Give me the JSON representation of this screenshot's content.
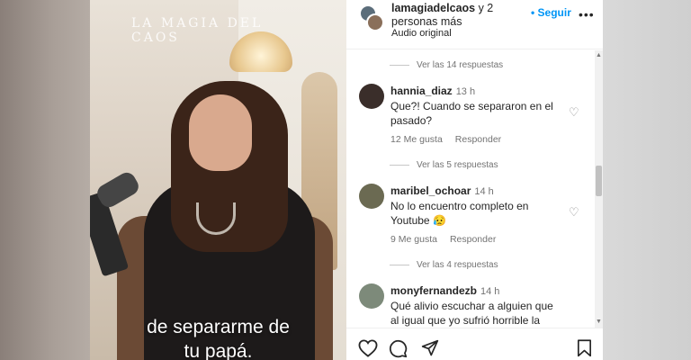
{
  "video": {
    "brand": "LA MAGIA DEL CAOS",
    "caption_line1": "de separarme de",
    "caption_line2": "tu papá."
  },
  "header": {
    "title": "lamagiadelcaos",
    "title_suffix": " y 2 personas más",
    "audio": "Audio original",
    "follow": "• Seguir",
    "more": "•••"
  },
  "replies": [
    {
      "label": "Ver las 14 respuestas"
    },
    {
      "label": "Ver las 5 respuestas"
    },
    {
      "label": "Ver las 4 respuestas"
    }
  ],
  "comments": [
    {
      "username": "hannia_diaz",
      "time": "13 h",
      "text": "Que?! Cuando se separaron en el pasado?",
      "likes": "12 Me gusta",
      "reply": "Responder"
    },
    {
      "username": "maribel_ochoar",
      "time": "14 h",
      "text": "No lo encuentro completo en Youtube 😥",
      "likes": "9 Me gusta",
      "reply": "Responder"
    },
    {
      "username": "monyfernandezb",
      "time": "14 h",
      "text": "Qué alivio escuchar a alguien que al igual que yo sufrió horrible la"
    }
  ],
  "icons": {
    "heart": "heart-icon",
    "comment": "comment-icon",
    "share": "share-icon",
    "save": "bookmark-icon"
  },
  "colors": {
    "accent": "#0095f6",
    "muted": "#737373"
  }
}
